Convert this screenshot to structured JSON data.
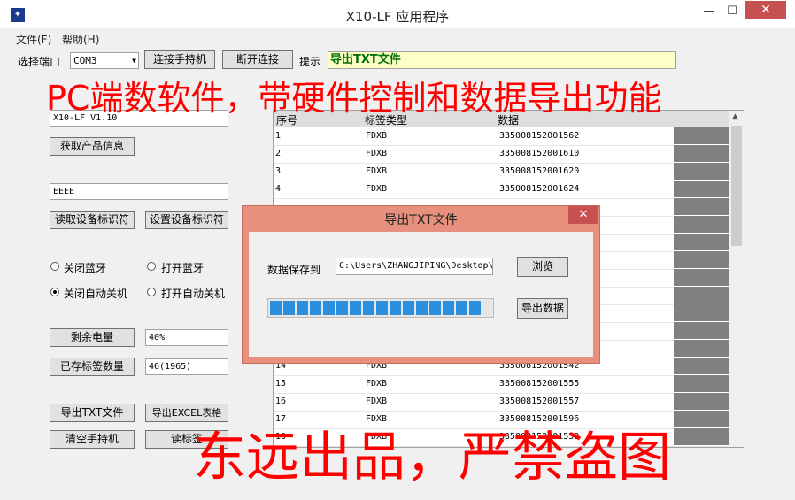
{
  "window": {
    "title": "X10-LF 应用程序",
    "minimize": "—",
    "maximize": "☐",
    "close": "✕"
  },
  "menu": {
    "file": "文件(F)",
    "help": "帮助(H)"
  },
  "toolbar": {
    "port_label": "选择端口",
    "port_value": "COM3",
    "connect": "连接手持机",
    "disconnect": "断开连接",
    "hint_label": "提示",
    "hint_value": "导出TXT文件"
  },
  "left": {
    "version": "X10-LF V1.10",
    "get_info": "获取产品信息",
    "device_id": "EEEE",
    "read_id": "读取设备标识符",
    "set_id": "设置设备标识符",
    "bt_off": "关闭蓝牙",
    "bt_on": "打开蓝牙",
    "auto_off_close": "关闭自动关机",
    "auto_off_open": "打开自动关机",
    "battery_btn": "剩余电量",
    "battery_value": "40%",
    "tags_btn": "已存标签数量",
    "tags_value": "46(1965)",
    "export_txt": "导出TXT文件",
    "export_excel": "导出EXCEL表格",
    "clear": "清空手持机",
    "read_tags": "读标签"
  },
  "table": {
    "headers": [
      "序号",
      "标签类型",
      "数据"
    ],
    "rows": [
      [
        "1",
        "FDXB",
        "335008152001562"
      ],
      [
        "2",
        "FDXB",
        "335008152001610"
      ],
      [
        "3",
        "FDXB",
        "335008152001620"
      ],
      [
        "4",
        "FDXB",
        "335008152001624"
      ],
      [
        "14",
        "FDXB",
        "335008152001542"
      ],
      [
        "15",
        "FDXB",
        "335008152001555"
      ],
      [
        "16",
        "FDXB",
        "335008152001557"
      ],
      [
        "17",
        "FDXB",
        "335008152001596"
      ],
      [
        "18",
        "FDXB",
        "335008152001553"
      ]
    ]
  },
  "dialog": {
    "title": "导出TXT文件",
    "close": "✕",
    "save_label": "数据保存到",
    "path": "C:\\Users\\ZHANGJIPING\\Desktop\\",
    "browse": "浏览",
    "export": "导出数据",
    "progress": 1.0,
    "accent": "#2b8fe0"
  },
  "overlay": {
    "top_text": "PC端数软件，带硬件控制和数据导出功能",
    "bottom_text": "东远出品，严禁盗图",
    "color": "#ff0000"
  }
}
